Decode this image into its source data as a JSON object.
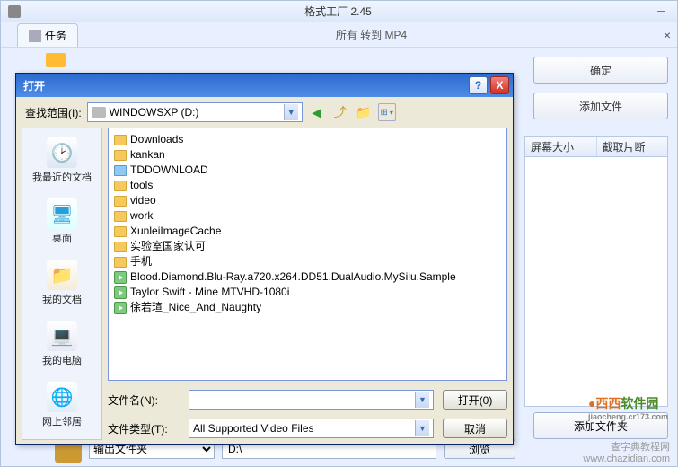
{
  "main_title": "格式工厂 2.45",
  "task_tab": "任务",
  "sub_title": "所有 转到 MP4",
  "right_buttons": {
    "ok": "确定",
    "add_file": "添加文件",
    "add_folder": "添加文件夹"
  },
  "columns": [
    "屏幕大小",
    "截取片断"
  ],
  "output": {
    "label": "输出文件夹",
    "path": "D:\\",
    "browse": "浏览"
  },
  "dialog": {
    "title": "打开",
    "look_in_label": "查找范围(I):",
    "look_in_value": "WINDOWSXP (D:)",
    "places": {
      "recent": "我最近的文档",
      "desktop": "桌面",
      "docs": "我的文档",
      "computer": "我的电脑",
      "network": "网上邻居"
    },
    "files": [
      {
        "type": "folder",
        "name": "Downloads"
      },
      {
        "type": "folder",
        "name": "kankan"
      },
      {
        "type": "folder-special",
        "name": "TDDOWNLOAD"
      },
      {
        "type": "folder",
        "name": "tools"
      },
      {
        "type": "folder",
        "name": "video"
      },
      {
        "type": "folder",
        "name": "work"
      },
      {
        "type": "folder",
        "name": "XunleiImageCache"
      },
      {
        "type": "folder",
        "name": "实验室国家认可"
      },
      {
        "type": "folder",
        "name": "手机"
      },
      {
        "type": "video",
        "name": "Blood.Diamond.Blu-Ray.a720.x264.DD51.DualAudio.MySilu.Sample"
      },
      {
        "type": "video",
        "name": "Taylor Swift - Mine MTVHD-1080i"
      },
      {
        "type": "video",
        "name": "徐若瑄_Nice_And_Naughty"
      }
    ],
    "filename_label": "文件名(N):",
    "filename_value": "",
    "filetype_label": "文件类型(T):",
    "filetype_value": "All Supported Video Files",
    "open_btn": "打开(0)",
    "cancel_btn": "取消"
  },
  "watermark1_a": "西西",
  "watermark1_b": "软件园",
  "watermark1_url": "jiaocheng.cr173.com",
  "watermark2": "查字典教程网\nwww.chazidian.com"
}
